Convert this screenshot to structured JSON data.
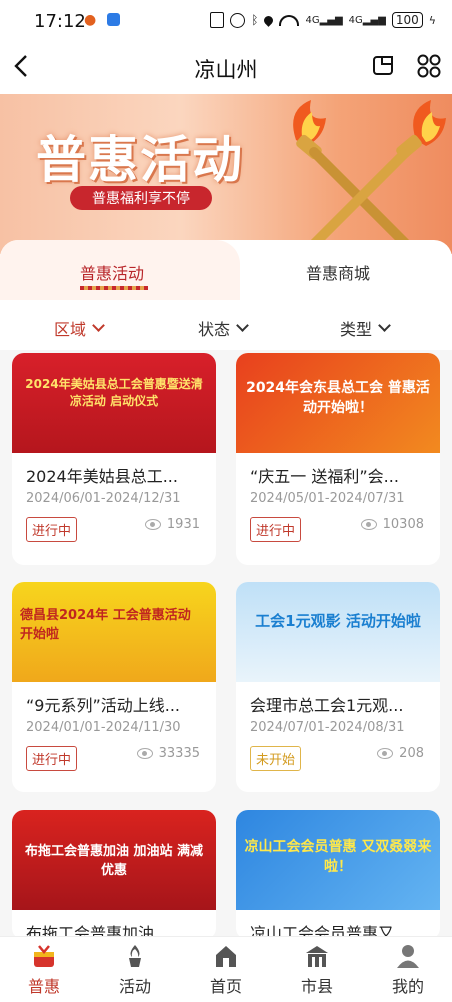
{
  "status_bar": {
    "time": "17:12",
    "battery": "100"
  },
  "header": {
    "title": "凉山州"
  },
  "banner": {
    "title": "普惠活动",
    "subtitle": "普惠福利享不停"
  },
  "tabs": [
    {
      "label": "普惠活动",
      "active": true
    },
    {
      "label": "普惠商城",
      "active": false
    }
  ],
  "filters": [
    {
      "label": "区域",
      "active": true
    },
    {
      "label": "状态",
      "active": false
    },
    {
      "label": "类型",
      "active": false
    }
  ],
  "cards": [
    {
      "thumb_text": "2024年美姑县总工会普惠暨送清凉活动 启动仪式",
      "title": "2024年美姑县总工...",
      "date": "2024/06/01-2024/12/31",
      "status": "进行中",
      "views": "1931"
    },
    {
      "thumb_text": "2024年会东县总工会 普惠活动开始啦！",
      "title": "“庆五一 送福利”会...",
      "date": "2024/05/01-2024/07/31",
      "status": "进行中",
      "views": "10308"
    },
    {
      "thumb_text": "德昌县2024年 工会普惠活动 开始啦",
      "title": "“9元系列”活动上线...",
      "date": "2024/01/01-2024/11/30",
      "status": "进行中",
      "views": "33335"
    },
    {
      "thumb_text": "工会1元观影 活动开始啦",
      "title": "会理市总工会1元观...",
      "date": "2024/07/01-2024/08/31",
      "status": "未开始",
      "views": "208"
    },
    {
      "thumb_text": "布拖工会普惠加油 加油站 满减优惠",
      "title": "布拖工会普惠加油",
      "date": "",
      "status": "",
      "views": ""
    },
    {
      "thumb_text": "凉山工会会员普惠 又双叒叕来啦！",
      "title": "凉山工会会员普惠又...",
      "date": "",
      "status": "",
      "views": ""
    }
  ],
  "bottom_nav": [
    {
      "label": "普惠",
      "icon": "gift-icon",
      "active": true
    },
    {
      "label": "活动",
      "icon": "torch-icon",
      "active": false
    },
    {
      "label": "首页",
      "icon": "home-icon",
      "active": false
    },
    {
      "label": "市县",
      "icon": "building-icon",
      "active": false
    },
    {
      "label": "我的",
      "icon": "user-icon",
      "active": false
    }
  ],
  "colors": {
    "accent": "#c0392b",
    "pending": "#d39b1f"
  }
}
